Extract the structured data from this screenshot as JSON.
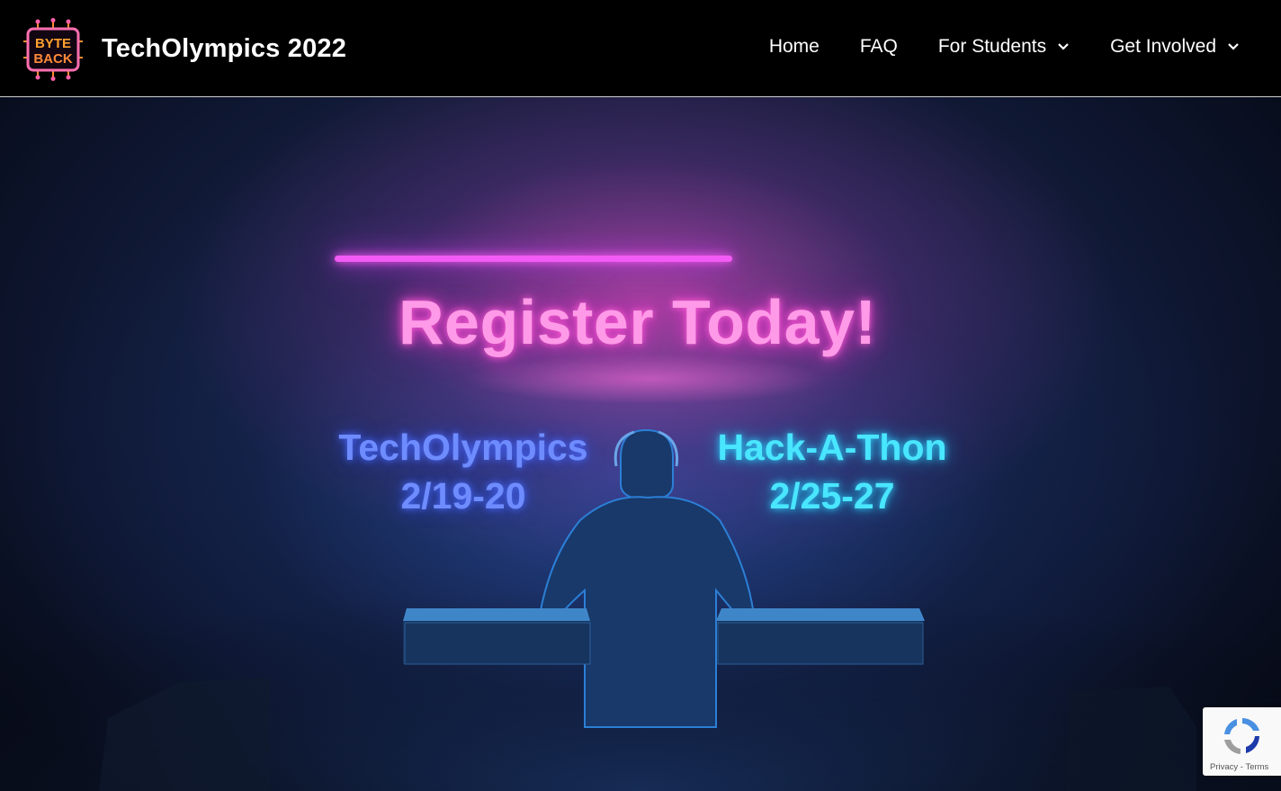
{
  "header": {
    "logo_text": "BYTE BACK",
    "site_title": "TechOlympics 2022"
  },
  "nav": {
    "items": [
      {
        "label": "Home",
        "has_dropdown": false
      },
      {
        "label": "FAQ",
        "has_dropdown": false
      },
      {
        "label": "For Students",
        "has_dropdown": true
      },
      {
        "label": "Get Involved",
        "has_dropdown": true
      }
    ]
  },
  "hero": {
    "headline": "Register Today!",
    "events": [
      {
        "name": "TechOlympics",
        "dates": "2/19-20"
      },
      {
        "name": "Hack-A-Thon",
        "dates": "2/25-27"
      }
    ]
  },
  "recaptcha": {
    "privacy": "Privacy",
    "separator": " - ",
    "terms": "Terms"
  },
  "colors": {
    "header_bg": "#000000",
    "neon_pink": "#ff9ae8",
    "neon_blue": "#6e8cff",
    "neon_cyan": "#49e6ff"
  }
}
